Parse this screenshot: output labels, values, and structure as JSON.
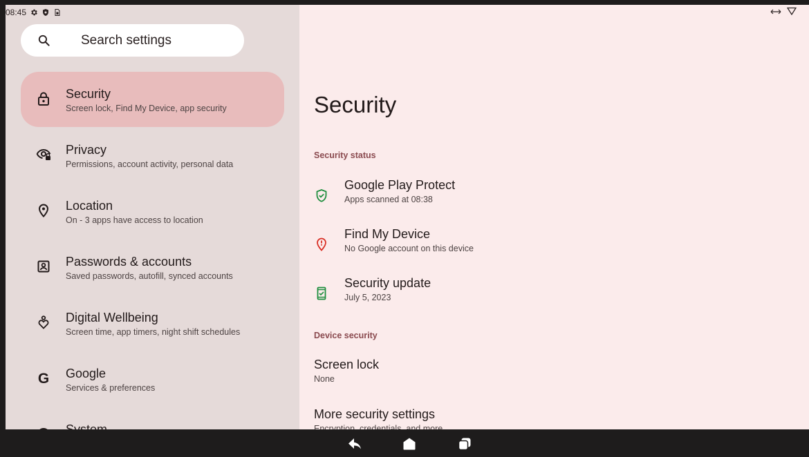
{
  "status_bar": {
    "time": "08:45"
  },
  "search": {
    "placeholder": "Search settings"
  },
  "sidebar": {
    "items": [
      {
        "title": "Security",
        "subtitle": "Screen lock, Find My Device, app security",
        "icon": "lock-icon",
        "selected": true
      },
      {
        "title": "Privacy",
        "subtitle": "Permissions, account activity, personal data",
        "icon": "privacy-eye-icon"
      },
      {
        "title": "Location",
        "subtitle": "On - 3 apps have access to location",
        "icon": "location-pin-icon"
      },
      {
        "title": "Passwords & accounts",
        "subtitle": "Saved passwords, autofill, synced accounts",
        "icon": "account-box-icon"
      },
      {
        "title": "Digital Wellbeing",
        "subtitle": "Screen time, app timers, night shift schedules",
        "icon": "wellbeing-heart-icon"
      },
      {
        "title": "Google",
        "subtitle": "Services & preferences",
        "icon": "google-g-icon",
        "glyph": "G"
      },
      {
        "title": "System",
        "subtitle": "",
        "icon": "system-info-icon"
      }
    ]
  },
  "main": {
    "title": "Security",
    "sections": [
      {
        "label": "Security status",
        "items": [
          {
            "title": "Google Play Protect",
            "subtitle": "Apps scanned at 08:38",
            "icon": "shield-check-icon",
            "color": "#1e8e3e"
          },
          {
            "title": "Find My Device",
            "subtitle": "No Google account on this device",
            "icon": "location-alert-icon",
            "color": "#d93025"
          },
          {
            "title": "Security update",
            "subtitle": "July 5, 2023",
            "icon": "phone-check-icon",
            "color": "#1e8e3e"
          }
        ]
      },
      {
        "label": "Device security",
        "items": [
          {
            "title": "Screen lock",
            "subtitle": "None"
          },
          {
            "title": "More security settings",
            "subtitle": "Encryption, credentials, and more"
          }
        ]
      }
    ]
  },
  "colors": {
    "sidebar_bg": "#e5dad9",
    "content_bg": "#fbebeb",
    "selected_bg": "#e8bcbc",
    "section_label": "#8a4a4f",
    "navbar_bg": "#1e1c1c"
  }
}
